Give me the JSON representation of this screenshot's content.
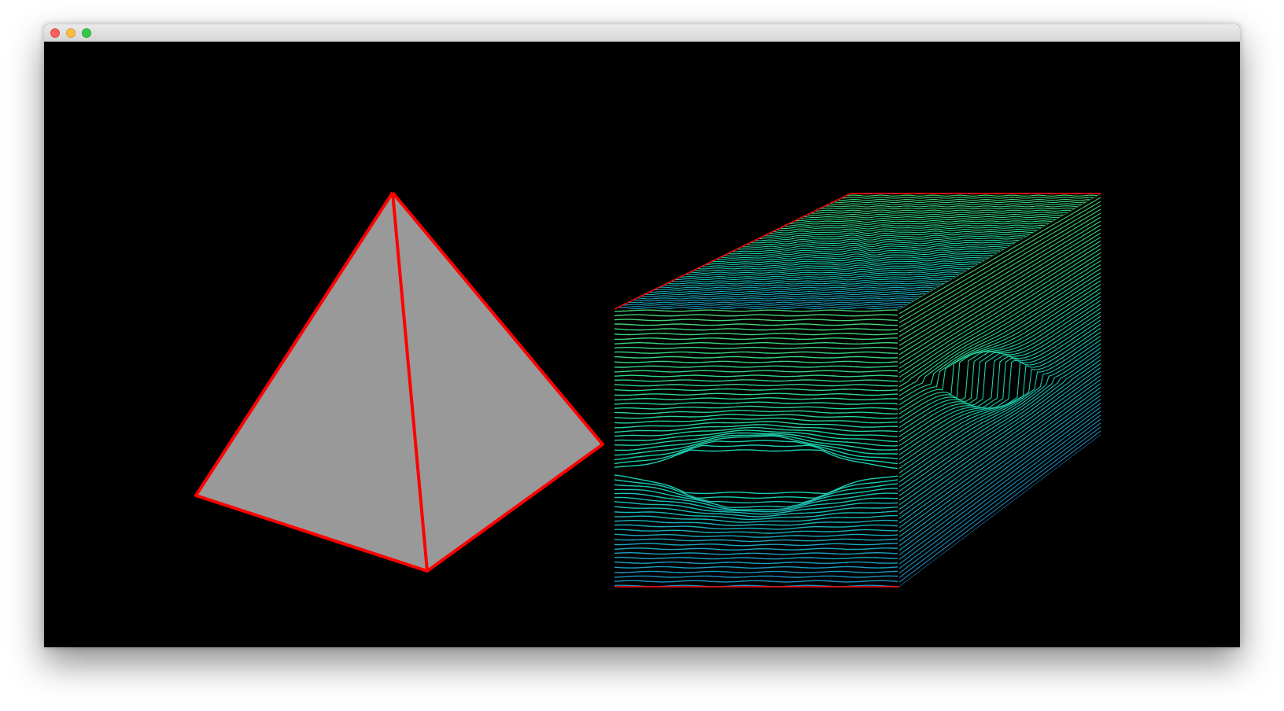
{
  "window": {
    "title": "",
    "buttons": [
      "close",
      "minimize",
      "zoom"
    ]
  },
  "scene": {
    "background": "#000000",
    "edge_color": "#ff0000",
    "pyramid": {
      "face_color": "#999999",
      "edge_color": "#ff0000"
    },
    "box": {
      "contour_palette": [
        "#1f6fb5",
        "#1aa6c2",
        "#19d0b0",
        "#2fd68a",
        "#4ad36a"
      ],
      "edge_color": "#ff0000"
    }
  }
}
